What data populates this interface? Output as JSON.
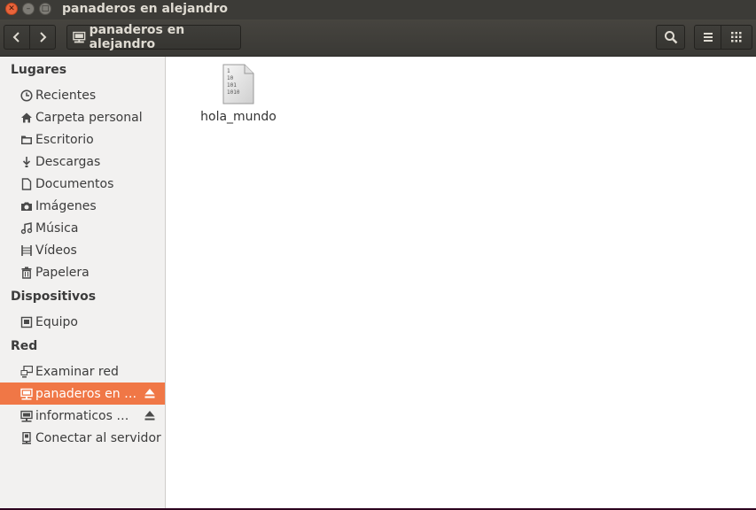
{
  "window": {
    "title": "panaderos en alejandro"
  },
  "toolbar": {
    "path_label": "panaderos en alejandro"
  },
  "sidebar": {
    "sections": [
      {
        "heading": "Lugares",
        "items": [
          {
            "label": "Recientes"
          },
          {
            "label": "Carpeta personal"
          },
          {
            "label": "Escritorio"
          },
          {
            "label": "Descargas"
          },
          {
            "label": "Documentos"
          },
          {
            "label": "Imágenes"
          },
          {
            "label": "Música"
          },
          {
            "label": "Vídeos"
          },
          {
            "label": "Papelera"
          }
        ]
      },
      {
        "heading": "Dispositivos",
        "items": [
          {
            "label": "Equipo"
          }
        ]
      },
      {
        "heading": "Red",
        "items": [
          {
            "label": "Examinar red"
          },
          {
            "label": "panaderos en …"
          },
          {
            "label": "informaticos …"
          },
          {
            "label": "Conectar al servidor"
          }
        ]
      }
    ]
  },
  "files": [
    {
      "name": "hola_mundo",
      "icon": "binary-file-icon",
      "icon_text": [
        "1",
        "10",
        "101",
        "1010"
      ]
    }
  ],
  "colors": {
    "accent": "#f07746",
    "titlebar": "#3c3b37",
    "close": "#e9643b"
  }
}
